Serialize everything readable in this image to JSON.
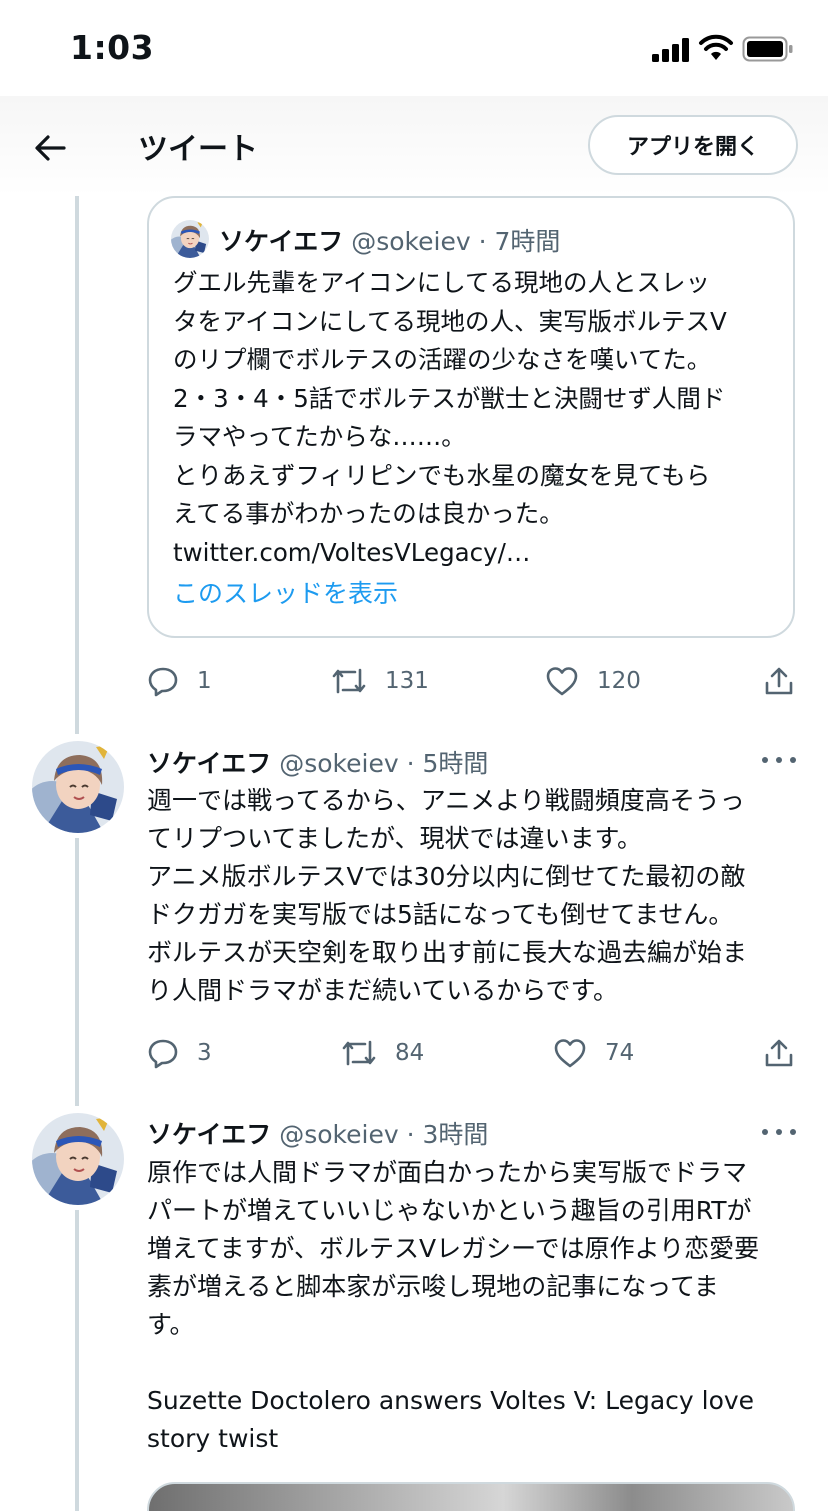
{
  "status_bar": {
    "time": "1:03"
  },
  "header": {
    "title": "ツイート",
    "open_app_label": "アプリを開く"
  },
  "quote_tweet": {
    "name": "ソケイエフ",
    "handle": "@sokeiev",
    "time": "7時間",
    "text": "グエル先輩をアイコンにしてる現地の人とスレッ\nタをアイコンにしてる現地の人、実写版ボルテスV\nのリプ欄でボルテスの活躍の少なさを嘆いてた。\n2・3・4・5話でボルテスが獣士と決闘せず人間ド\nラマやってたからな……。\nとりあえずフィリピンでも水星の魔女を見てもら\nえてる事がわかったのは良かった。\ntwitter.com/VoltesVLegacy/…",
    "show_thread": "このスレッドを表示",
    "actions": {
      "replies": "1",
      "retweets": "131",
      "likes": "120"
    }
  },
  "tweets": [
    {
      "name": "ソケイエフ",
      "handle": "@sokeiev",
      "time": "5時間",
      "text": "週一では戦ってるから、アニメより戦闘頻度高そうっ\nてリプついてましたが、現状では違います。\nアニメ版ボルテスVでは30分以内に倒せてた最初の敵\nドクガガを実写版では5話になっても倒せてません。\nボルテスが天空剣を取り出す前に長大な過去編が始ま\nり人間ドラマがまだ続いているからです。",
      "actions": {
        "replies": "3",
        "retweets": "84",
        "likes": "74"
      }
    },
    {
      "name": "ソケイエフ",
      "handle": "@sokeiev",
      "time": "3時間",
      "text": "原作では人間ドラマが面白かったから実写版でドラマ\nパートが増えていいじゃないかという趣旨の引用RTが\n増えてますが、ボルテスVレガシーでは原作より恋愛要\n素が増えると脚本家が示唆し現地の記事になってま\nす。\n\nSuzette Doctolero answers Voltes V: Legacy love\nstory twist"
    }
  ],
  "colors": {
    "accent": "#1d9bf0",
    "secondary_text": "#536471",
    "border": "#cfd9de"
  },
  "icons": [
    "back-arrow-icon",
    "reply-icon",
    "retweet-icon",
    "like-icon",
    "share-icon",
    "more-icon"
  ]
}
